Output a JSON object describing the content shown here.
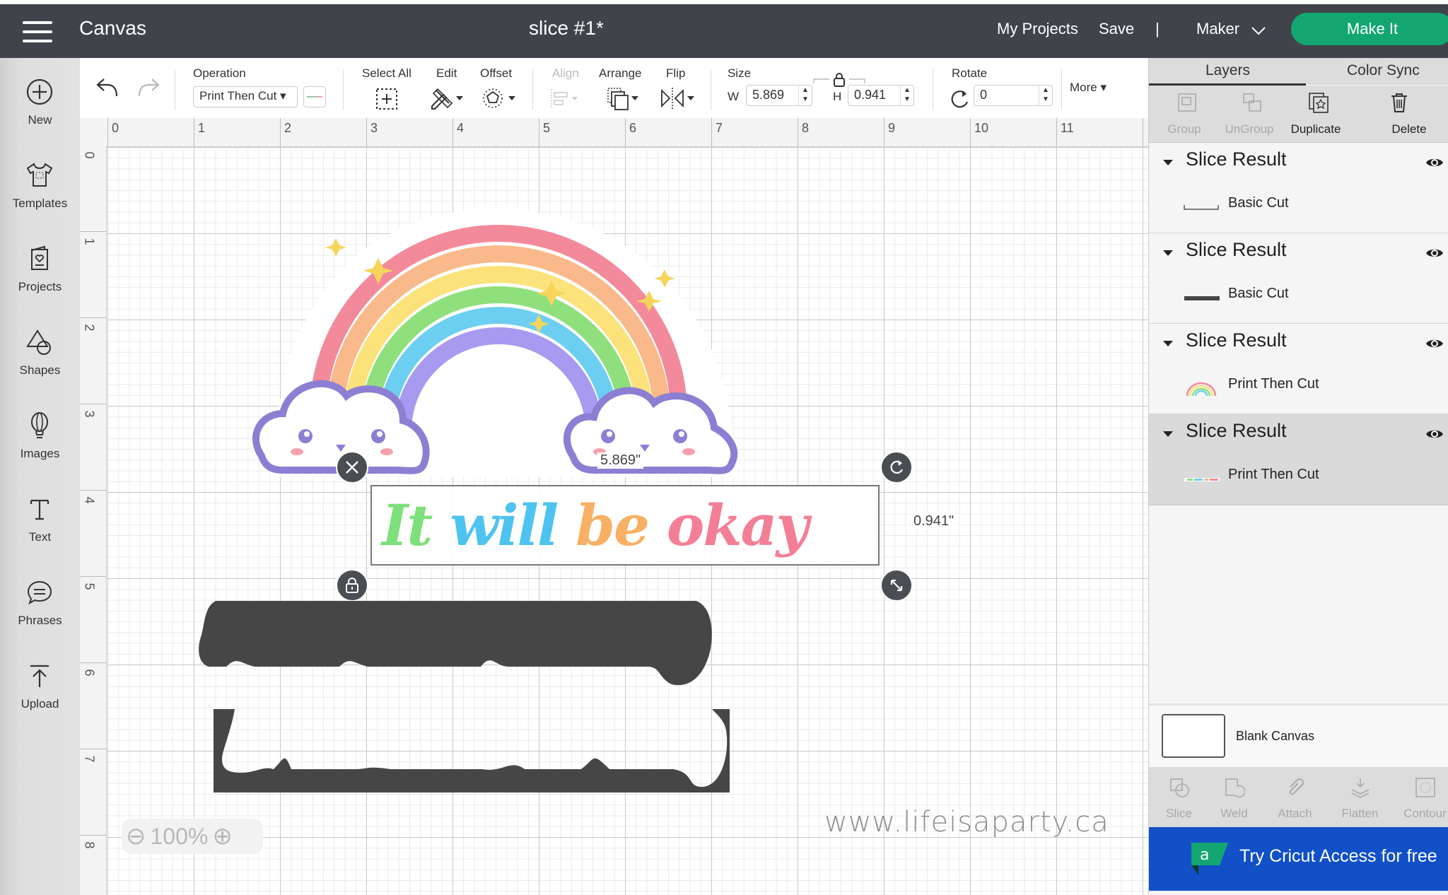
{
  "header": {
    "app_title": "Canvas",
    "document_title": "slice #1*",
    "my_projects": "My Projects",
    "save": "Save",
    "separator": "|",
    "machine": "Maker",
    "make_it": "Make It",
    "accent_color": "#14a672"
  },
  "sidebar": {
    "items": [
      {
        "label": "New",
        "icon": "plus-circle-icon"
      },
      {
        "label": "Templates",
        "icon": "tshirt-icon"
      },
      {
        "label": "Projects",
        "icon": "card-heart-icon"
      },
      {
        "label": "Shapes",
        "icon": "shapes-icon"
      },
      {
        "label": "Images",
        "icon": "balloon-icon"
      },
      {
        "label": "Text",
        "icon": "text-icon"
      },
      {
        "label": "Phrases",
        "icon": "speech-bubble-icon"
      },
      {
        "label": "Upload",
        "icon": "upload-icon"
      }
    ]
  },
  "toolbar": {
    "operation_label": "Operation",
    "operation_value": "Print Then Cut ▾",
    "select_all": "Select All",
    "edit": "Edit",
    "offset": "Offset",
    "align": "Align",
    "arrange": "Arrange",
    "flip": "Flip",
    "size": "Size",
    "w_label": "W",
    "w_value": "5.869",
    "h_label": "H",
    "h_value": "0.941",
    "rotate": "Rotate",
    "rotate_value": "0",
    "more": "More ▾"
  },
  "rulers": {
    "horizontal": [
      "0",
      "1",
      "2",
      "3",
      "4",
      "5",
      "6",
      "7",
      "8",
      "9",
      "10",
      "11"
    ],
    "vertical": [
      "0",
      "1",
      "2",
      "3",
      "4",
      "5",
      "6",
      "7",
      "8"
    ]
  },
  "canvas": {
    "phrase_words": [
      {
        "text": "It",
        "color": "#7ee07a"
      },
      {
        "text": "will",
        "color": "#4fc3ef"
      },
      {
        "text": "be",
        "color": "#f7b064"
      },
      {
        "text": "okay",
        "color": "#f27f96"
      }
    ],
    "width_readout": "5.869\"",
    "height_readout": "0.941\"",
    "zoom_minus": "⊖",
    "zoom_level": "100%",
    "zoom_plus": "⊕",
    "watermark": "www.lifeisaparty.ca"
  },
  "right_panel": {
    "tabs": [
      "Layers",
      "Color Sync"
    ],
    "actions": [
      {
        "label": "Group",
        "enabled": false
      },
      {
        "label": "UnGroup",
        "enabled": false
      },
      {
        "label": "Duplicate",
        "enabled": true
      },
      {
        "label": "Delete",
        "enabled": true
      }
    ],
    "layers": [
      {
        "title": "Slice Result",
        "sub": "Basic Cut",
        "selected": false
      },
      {
        "title": "Slice Result",
        "sub": "Basic Cut",
        "selected": false
      },
      {
        "title": "Slice Result",
        "sub": "Print Then Cut",
        "selected": false
      },
      {
        "title": "Slice Result",
        "sub": "Print Then Cut",
        "selected": true
      }
    ],
    "blank_canvas": "Blank Canvas",
    "bottom_actions": [
      "Slice",
      "Weld",
      "Attach",
      "Flatten",
      "Contour"
    ],
    "access_banner": "Try Cricut Access for free",
    "access_color": "#1150c6"
  }
}
